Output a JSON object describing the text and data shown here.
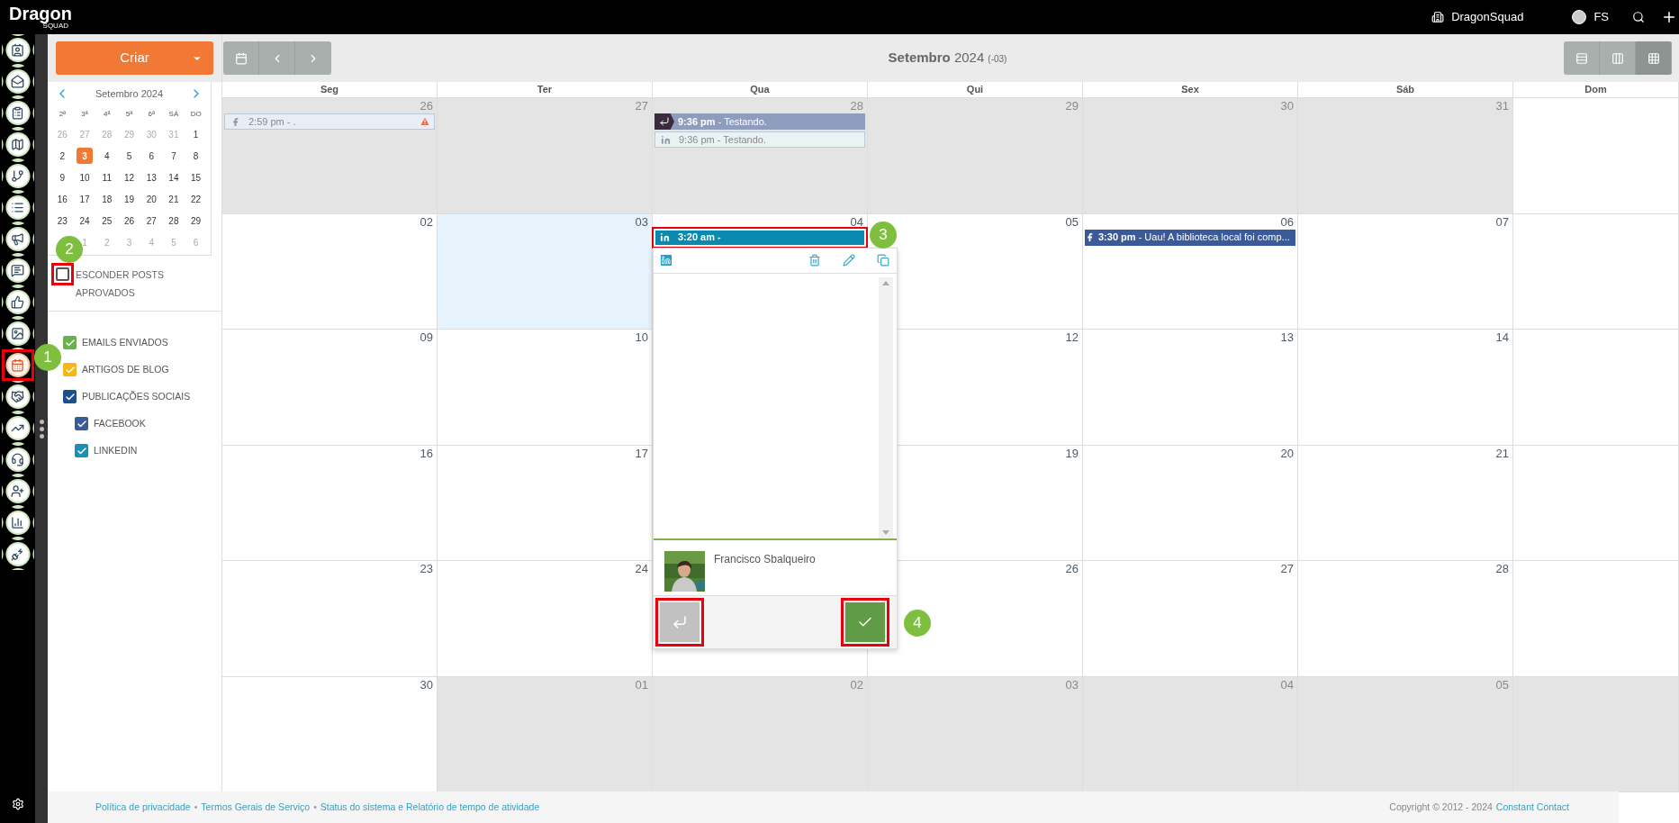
{
  "topbar": {
    "logo": "Dragon",
    "logo_sub": "SQUAD",
    "account": "DragonSquad",
    "user": "FS"
  },
  "rail": [
    {
      "selected": false,
      "highlighted": false
    },
    {
      "selected": false,
      "highlighted": false
    },
    {
      "selected": false,
      "highlighted": false
    },
    {
      "selected": false,
      "highlighted": false
    },
    {
      "selected": false,
      "highlighted": false
    },
    {
      "selected": false,
      "highlighted": false
    },
    {
      "selected": false,
      "highlighted": false
    },
    {
      "selected": false,
      "highlighted": false
    },
    {
      "selected": false,
      "highlighted": false
    },
    {
      "selected": false,
      "highlighted": false
    },
    {
      "selected": true,
      "highlighted": true
    },
    {
      "selected": false,
      "highlighted": false
    },
    {
      "selected": false,
      "highlighted": false
    },
    {
      "selected": false,
      "highlighted": false
    },
    {
      "selected": false,
      "highlighted": false
    },
    {
      "selected": false,
      "highlighted": false
    },
    {
      "selected": false,
      "highlighted": false
    }
  ],
  "create_button": "Criar",
  "mini_calendar": {
    "title": "Setembro 2024",
    "weekdays": [
      "2ª",
      "3ª",
      "4ª",
      "5ª",
      "6ª",
      "SÁ",
      "DO"
    ],
    "weeks": [
      [
        {
          "day": "26",
          "outside": true,
          "selected": false
        },
        {
          "day": "27",
          "outside": true,
          "selected": false
        },
        {
          "day": "28",
          "outside": true,
          "selected": false
        },
        {
          "day": "29",
          "outside": true,
          "selected": false
        },
        {
          "day": "30",
          "outside": true,
          "selected": false
        },
        {
          "day": "31",
          "outside": true,
          "selected": false
        },
        {
          "day": "1",
          "outside": false,
          "selected": false
        }
      ],
      [
        {
          "day": "2",
          "outside": false,
          "selected": false
        },
        {
          "day": "3",
          "outside": false,
          "selected": true
        },
        {
          "day": "4",
          "outside": false,
          "selected": false
        },
        {
          "day": "5",
          "outside": false,
          "selected": false
        },
        {
          "day": "6",
          "outside": false,
          "selected": false
        },
        {
          "day": "7",
          "outside": false,
          "selected": false
        },
        {
          "day": "8",
          "outside": false,
          "selected": false
        }
      ],
      [
        {
          "day": "9",
          "outside": false,
          "selected": false
        },
        {
          "day": "10",
          "outside": false,
          "selected": false
        },
        {
          "day": "11",
          "outside": false,
          "selected": false
        },
        {
          "day": "12",
          "outside": false,
          "selected": false
        },
        {
          "day": "13",
          "outside": false,
          "selected": false
        },
        {
          "day": "14",
          "outside": false,
          "selected": false
        },
        {
          "day": "15",
          "outside": false,
          "selected": false
        }
      ],
      [
        {
          "day": "16",
          "outside": false,
          "selected": false
        },
        {
          "day": "17",
          "outside": false,
          "selected": false
        },
        {
          "day": "18",
          "outside": false,
          "selected": false
        },
        {
          "day": "19",
          "outside": false,
          "selected": false
        },
        {
          "day": "20",
          "outside": false,
          "selected": false
        },
        {
          "day": "21",
          "outside": false,
          "selected": false
        },
        {
          "day": "22",
          "outside": false,
          "selected": false
        }
      ],
      [
        {
          "day": "23",
          "outside": false,
          "selected": false
        },
        {
          "day": "24",
          "outside": false,
          "selected": false
        },
        {
          "day": "25",
          "outside": false,
          "selected": false
        },
        {
          "day": "26",
          "outside": false,
          "selected": false
        },
        {
          "day": "27",
          "outside": false,
          "selected": false
        },
        {
          "day": "28",
          "outside": false,
          "selected": false
        },
        {
          "day": "29",
          "outside": false,
          "selected": false
        }
      ],
      [
        {
          "day": "1",
          "outside": true,
          "selected": false
        },
        {
          "day": "2",
          "outside": true,
          "selected": false
        },
        {
          "day": "3",
          "outside": true,
          "selected": false
        },
        {
          "day": "4",
          "outside": true,
          "selected": false
        },
        {
          "day": "5",
          "outside": true,
          "selected": false
        },
        {
          "day": "6",
          "outside": true,
          "selected": false
        }
      ]
    ]
  },
  "hide_approved": {
    "label": "ESCONDER POSTS APROVADOS",
    "checked": false,
    "highlighted": true
  },
  "filters": [
    {
      "label": "EMAILS ENVIADOS",
      "checked": true,
      "color": "#6ab04c"
    },
    {
      "label": "ARTIGOS DE BLOG",
      "checked": true,
      "color": "#f5b716"
    },
    {
      "label": "PUBLICAÇÕES SOCIAIS",
      "checked": true,
      "color": "#1d4f8c",
      "children": [
        {
          "label": "FACEBOOK",
          "checked": true,
          "color": "#3b5a9a"
        },
        {
          "label": "LINKEDIN",
          "checked": true,
          "color": "#1b8fb5"
        }
      ]
    }
  ],
  "toolbar": {
    "title": "**Setembro** 2024",
    "timezone": "(-03)",
    "views": [
      {
        "selected": false
      },
      {
        "selected": false
      },
      {
        "selected": true
      }
    ]
  },
  "calendar": {
    "columns": [
      "Seg",
      "Ter",
      "Qua",
      "Qui",
      "Sex",
      "Sáb",
      "Dom"
    ],
    "weeks": [
      [
        {
          "day": "26",
          "outside": true,
          "today": false,
          "events": [
            {
              "kind": "facebook",
              "faded": true,
              "returned": false,
              "text": "2:59 pm - .",
              "warning": true,
              "highlighted": false
            }
          ]
        },
        {
          "day": "27",
          "outside": true,
          "today": false
        },
        {
          "day": "28",
          "outside": true,
          "today": false,
          "events": [
            {
              "kind": "linkedin",
              "faded": false,
              "returned": true,
              "text": "**9:36 pm** - Testando.",
              "warning": false,
              "highlighted": false
            },
            {
              "kind": "linkedin",
              "faded": true,
              "returned": false,
              "text": "9:36 pm - Testando.",
              "warning": false,
              "highlighted": false
            }
          ]
        },
        {
          "day": "29",
          "outside": true,
          "today": false
        },
        {
          "day": "30",
          "outside": true,
          "today": false
        },
        {
          "day": "31",
          "outside": true,
          "today": false
        },
        {
          "outside": false,
          "today": false
        }
      ],
      [
        {
          "day": "02",
          "outside": false,
          "today": false
        },
        {
          "day": "03",
          "outside": false,
          "today": true
        },
        {
          "day": "04",
          "outside": false,
          "today": false,
          "events": [
            {
              "kind": "linkedin",
              "faded": false,
              "returned": false,
              "text": "**3:20 am -**",
              "warning": false,
              "highlighted": true
            }
          ]
        },
        {
          "day": "05",
          "outside": false,
          "today": false
        },
        {
          "day": "06",
          "outside": false,
          "today": false,
          "events": [
            {
              "kind": "facebook",
              "faded": false,
              "returned": false,
              "text": "**3:30 pm** - Uau! A biblioteca local foi comp...",
              "warning": false,
              "highlighted": false
            }
          ]
        },
        {
          "day": "07",
          "outside": false,
          "today": false
        },
        {
          "outside": false,
          "today": false
        }
      ],
      [
        {
          "day": "09",
          "outside": false,
          "today": false
        },
        {
          "day": "10",
          "outside": false,
          "today": false
        },
        {
          "day": "12",
          "outside": false,
          "today": false
        },
        {
          "day": "13",
          "outside": false,
          "today": false
        },
        {
          "day": "14",
          "outside": false,
          "today": false
        },
        {
          "outside": false,
          "today": false
        }
      ],
      [
        {
          "day": "16",
          "outside": false,
          "today": false
        },
        {
          "day": "17",
          "outside": false,
          "today": false
        },
        {
          "day": "19",
          "outside": false,
          "today": false
        },
        {
          "day": "20",
          "outside": false,
          "today": false
        },
        {
          "day": "21",
          "outside": false,
          "today": false
        },
        {
          "outside": false,
          "today": false
        }
      ],
      [
        {
          "day": "23",
          "outside": false,
          "today": false
        },
        {
          "day": "24",
          "outside": false,
          "today": false
        },
        {
          "day": "26",
          "outside": false,
          "today": false
        },
        {
          "day": "27",
          "outside": false,
          "today": false
        },
        {
          "day": "28",
          "outside": false,
          "today": false
        },
        {
          "outside": false,
          "today": false
        }
      ],
      [
        {
          "day": "30",
          "outside": false,
          "today": false
        },
        {
          "day": "01",
          "outside": true,
          "today": false
        },
        {
          "day": "02",
          "outside": true,
          "today": false
        },
        {
          "day": "03",
          "outside": true,
          "today": false
        },
        {
          "day": "04",
          "outside": true,
          "today": false
        },
        {
          "day": "05",
          "outside": true,
          "today": false
        },
        {
          "outside": true,
          "today": false
        }
      ]
    ]
  },
  "post_popup": {
    "author": "Francisco Sbalqueiro",
    "reply_highlighted": true,
    "approve_highlighted": true
  },
  "callouts": [
    "1",
    "2",
    "3",
    "4"
  ],
  "footer": {
    "links": [
      "Política de privacidade",
      "Termos Gerais de Serviço",
      "Status do sistema e Relatório de tempo de atividade"
    ],
    "separator": "•",
    "copyright": "Copyright © 2012 - 2024",
    "company": "Constant Contact"
  }
}
